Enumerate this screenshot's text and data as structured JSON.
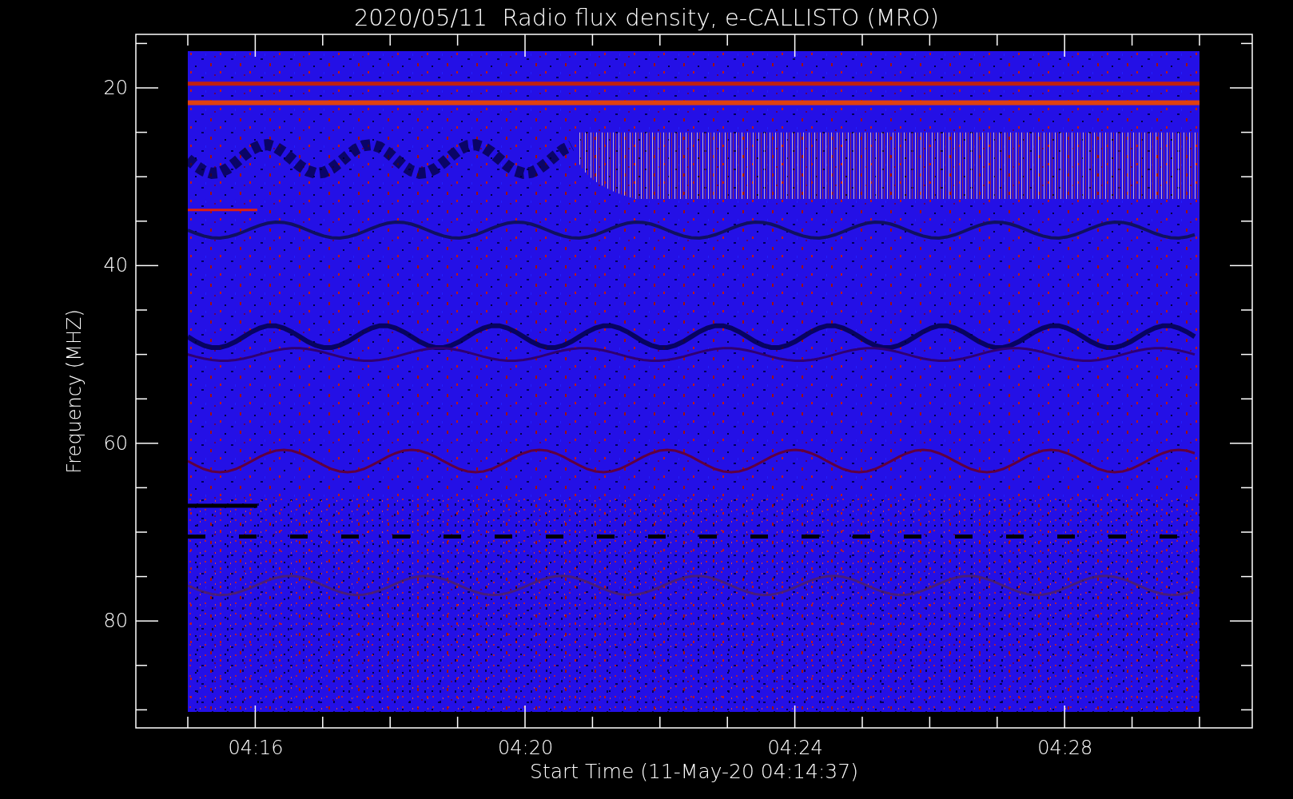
{
  "title": "2020/05/11  Radio flux density, e-CALLISTO (MRO)",
  "y_axis": {
    "label": "Frequency (MHZ)",
    "ticks": [
      "20",
      "40",
      "60",
      "80"
    ]
  },
  "x_axis": {
    "label": "Start Time (11-May-20 04:14:37)",
    "ticks": [
      "04:16",
      "04:20",
      "04:24",
      "04:28"
    ]
  }
}
